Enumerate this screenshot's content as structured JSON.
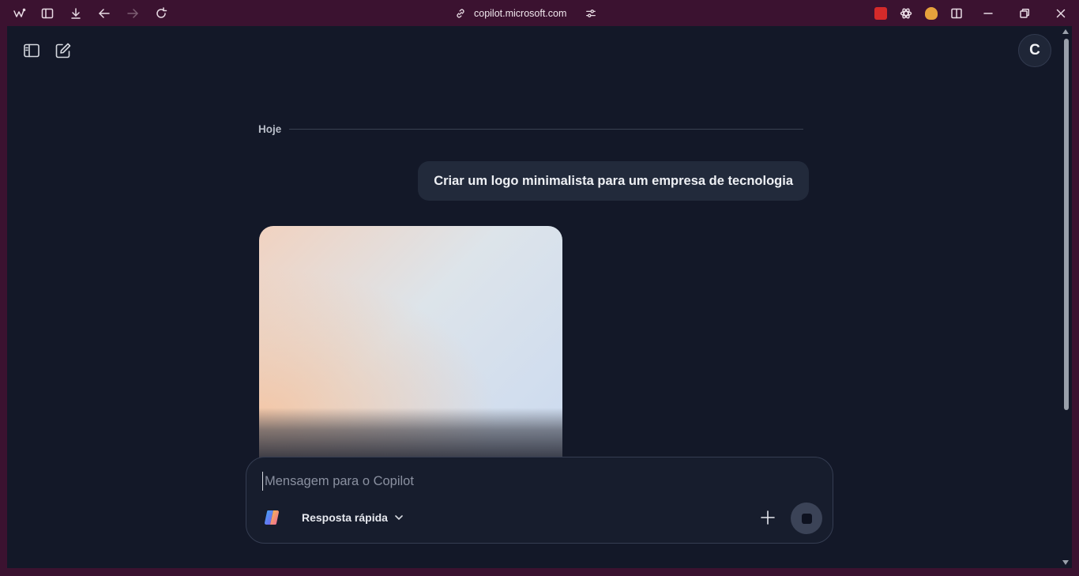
{
  "browser": {
    "url": "copilot.microsoft.com",
    "icons": {
      "browser_logo": "wave-logo-icon",
      "sidebar": "sidebar-icon",
      "downloads": "download-icon",
      "back": "arrow-left-icon",
      "forward": "arrow-right-icon",
      "reload": "reload-icon",
      "link": "link-icon",
      "site_settings": "sliders-icon",
      "split": "split-view-icon",
      "minimize": "minimize-icon",
      "restore": "restore-icon",
      "close": "close-icon"
    },
    "colors": {
      "frame": "#3b1230",
      "page": "#131828"
    }
  },
  "page": {
    "avatar_initial": "C",
    "day_label": "Hoje",
    "user_message": "Criar um logo minimalista para um empresa de tecnologia",
    "composer": {
      "placeholder": "Mensagem para o Copilot",
      "value": "",
      "mode_label": "Resposta rápida"
    }
  }
}
